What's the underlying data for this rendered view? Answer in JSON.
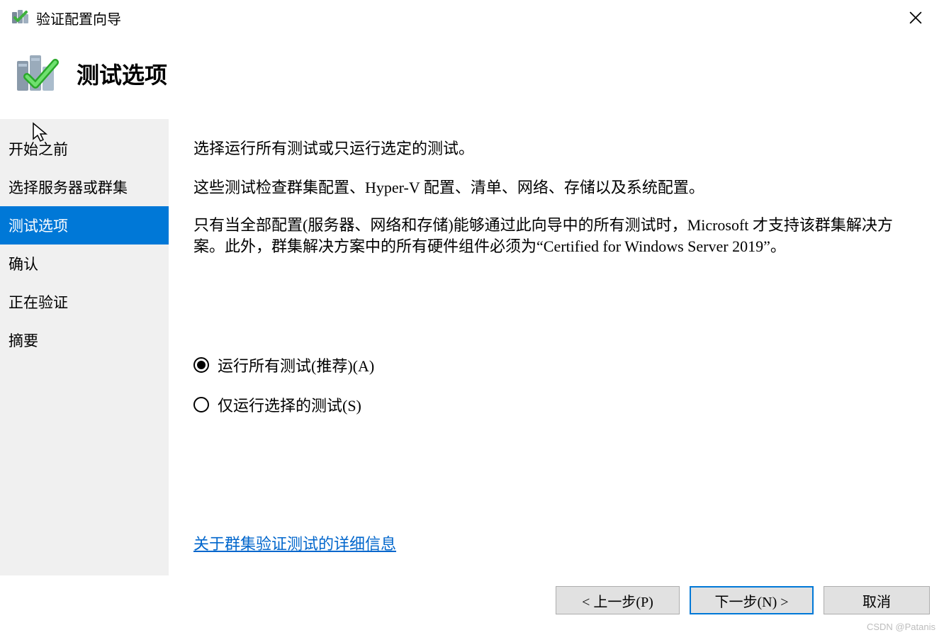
{
  "window": {
    "title": "验证配置向导"
  },
  "header": {
    "title": "测试选项"
  },
  "sidebar": {
    "items": [
      {
        "label": "开始之前",
        "active": false
      },
      {
        "label": "选择服务器或群集",
        "active": false
      },
      {
        "label": "测试选项",
        "active": true
      },
      {
        "label": "确认",
        "active": false
      },
      {
        "label": "正在验证",
        "active": false
      },
      {
        "label": "摘要",
        "active": false
      }
    ]
  },
  "content": {
    "para1": "选择运行所有测试或只运行选定的测试。",
    "para2": "这些测试检查群集配置、Hyper-V 配置、清单、网络、存储以及系统配置。",
    "para3": "只有当全部配置(服务器、网络和存储)能够通过此向导中的所有测试时，Microsoft 才支持该群集解决方案。此外，群集解决方案中的所有硬件组件必须为“Certified for Windows Server 2019”。",
    "radio": {
      "option1": "运行所有测试(推荐)(A)",
      "option2": "仅运行选择的测试(S)",
      "selected": 0
    },
    "link": "关于群集验证测试的详细信息"
  },
  "buttons": {
    "previous": "< 上一步(P)",
    "next": "下一步(N) >",
    "cancel": "取消"
  },
  "watermark": "CSDN @Patanis"
}
